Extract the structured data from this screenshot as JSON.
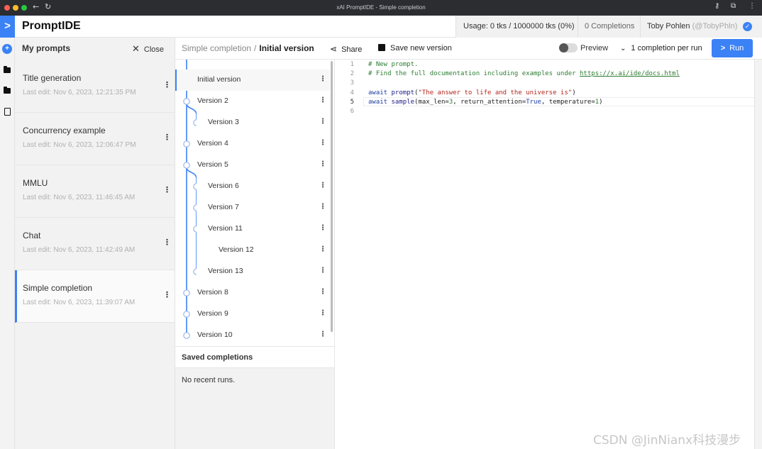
{
  "browser": {
    "title": "xAI PromptIDE - Simple completion",
    "back_icon": "arrow-left-icon",
    "reload_icon": "reload-icon"
  },
  "app": {
    "brand": "PromptIDE",
    "usage": "Usage: 0 tks / 1000000 tks (0%)",
    "completions": "0 Completions",
    "user_name": "Toby Pohlen",
    "user_handle": "(@TobyPhln)",
    "accent": "#3b82f6"
  },
  "prompts_panel": {
    "title": "My prompts",
    "close_label": "Close",
    "items": [
      {
        "name": "Title generation",
        "edited": "Last edit: Nov 6, 2023, 12:21:35 PM"
      },
      {
        "name": "Concurrency example",
        "edited": "Last edit: Nov 6, 2023, 12:06:47 PM"
      },
      {
        "name": "MMLU",
        "edited": "Last edit: Nov 6, 2023, 11:46:45 AM"
      },
      {
        "name": "Chat",
        "edited": "Last edit: Nov 6, 2023, 11:42:49 AM"
      },
      {
        "name": "Simple completion",
        "edited": "Last edit: Nov 6, 2023, 11:39:07 AM"
      }
    ]
  },
  "toolbar": {
    "crumb_parent": "Simple completion",
    "crumb_sep": "/",
    "crumb_current": "Initial version",
    "share": "Share",
    "save_new_version": "Save new version",
    "preview": "Preview",
    "completions_per_run": "1 completion per run",
    "run": "Run"
  },
  "versions": [
    "Initial version",
    "Version 2",
    "Version 3",
    "Version 4",
    "Version 5",
    "Version 6",
    "Version 7",
    "Version 11",
    "Version 12",
    "Version 13",
    "Version 8",
    "Version 9",
    "Version 10"
  ],
  "saved_completions": {
    "title": "Saved completions",
    "empty": "No recent runs."
  },
  "editor": {
    "line_numbers": [
      "1",
      "2",
      "3",
      "4",
      "5",
      "6"
    ],
    "lines": {
      "l1": "# New prompt.",
      "l2_pre": "# Find the full documentation including examples under ",
      "l2_link": "https://x.ai/ide/docs.html",
      "l4_kw": "await ",
      "l4_fn": "prompt",
      "l4_open": "(",
      "l4_str": "\"The answer to life and the universe is\"",
      "l4_close": ")",
      "l5_kw": "await ",
      "l5_fn": "sample",
      "l5_open": "(max_len=",
      "l5_n1": "3",
      "l5_mid": ", return_attention=",
      "l5_kw2": "True",
      "l5_mid2": ", temperature=",
      "l5_n2": "1",
      "l5_close": ")"
    }
  },
  "watermark": "CSDN @JinNianx科技漫步"
}
